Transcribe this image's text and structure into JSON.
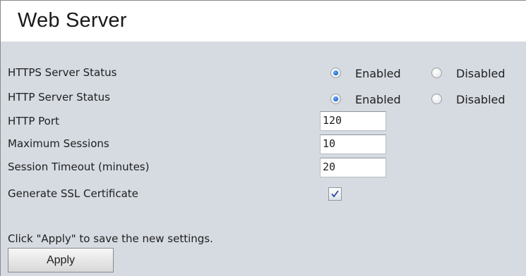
{
  "page": {
    "title": "Web Server"
  },
  "https_status": {
    "label": "HTTPS Server Status",
    "options": [
      "Enabled",
      "Disabled"
    ],
    "selected": "Enabled"
  },
  "http_status": {
    "label": "HTTP Server Status",
    "options": [
      "Enabled",
      "Disabled"
    ],
    "selected": "Enabled"
  },
  "http_port": {
    "label": "HTTP Port",
    "value": "120"
  },
  "max_sessions": {
    "label": "Maximum Sessions",
    "value": "10"
  },
  "session_timeout": {
    "label": "Session Timeout (minutes)",
    "value": "20"
  },
  "ssl_cert": {
    "label": "Generate SSL Certificate",
    "checked": true
  },
  "footer": {
    "note": "Click \"Apply\" to save the new settings.",
    "apply_label": "Apply"
  }
}
